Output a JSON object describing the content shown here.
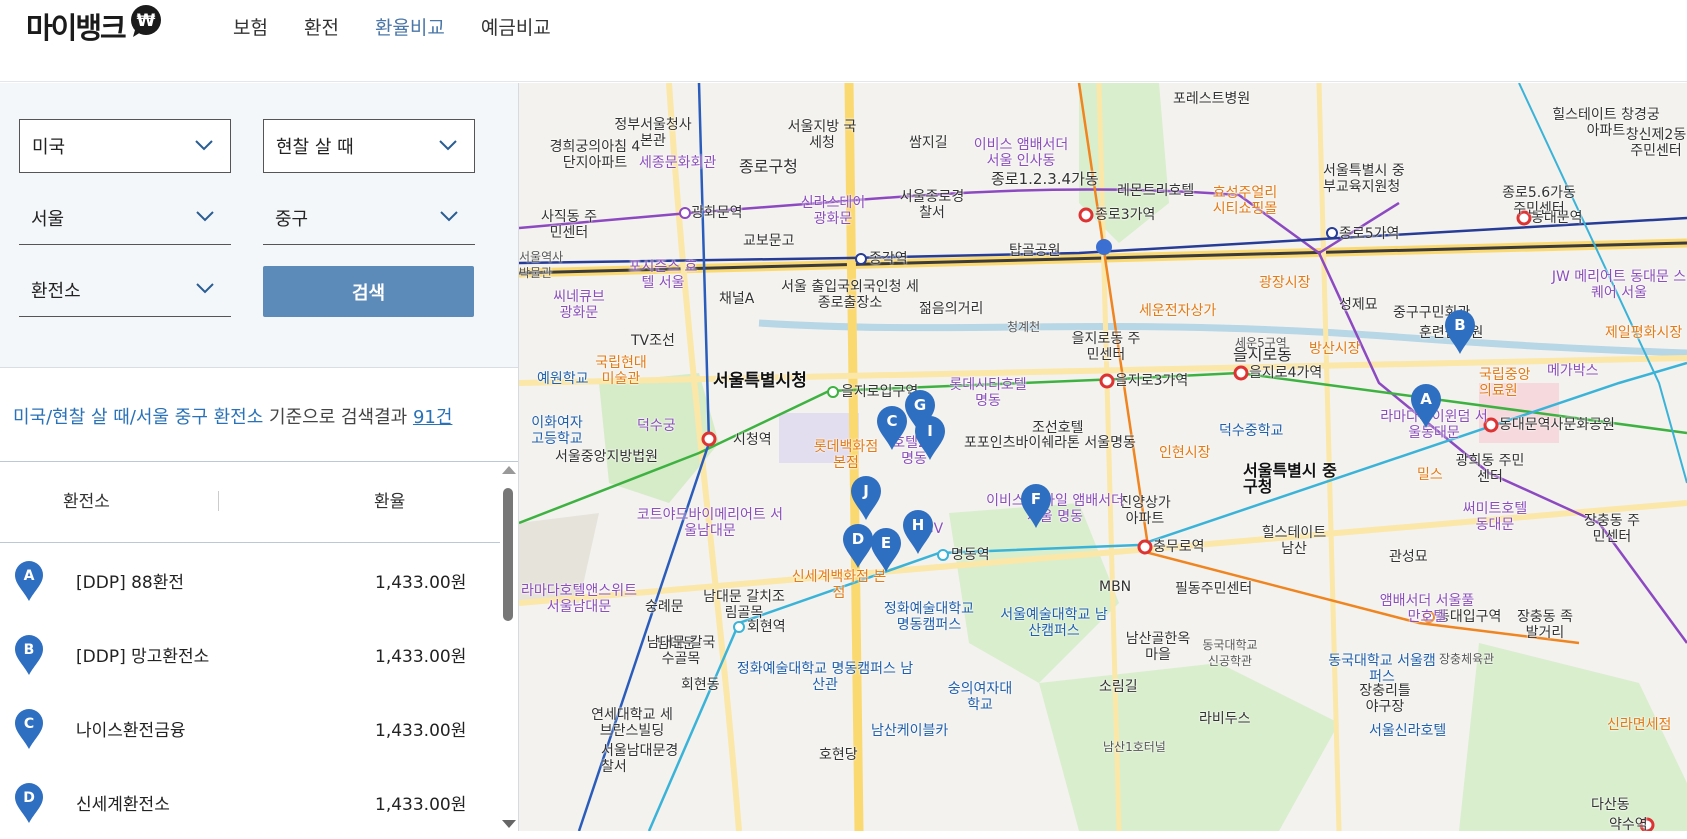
{
  "brand": {
    "logo_text": "마이뱅크",
    "logo_badge": "₩"
  },
  "nav": [
    {
      "label": "보험"
    },
    {
      "label": "환전"
    },
    {
      "label": "환율비교"
    },
    {
      "label": "예금비교"
    }
  ],
  "filters": {
    "country": "미국",
    "trade_type": "현찰 살 때",
    "region": "서울",
    "district": "중구",
    "place_type": "환전소",
    "search_label": "검색"
  },
  "summary": {
    "query": "미국/현찰 살 때/서울 중구 환전소",
    "middle": " 기준으로 검색결과 ",
    "count": "91건"
  },
  "table": {
    "col_name": "환전소",
    "col_rate": "환율",
    "rows": [
      {
        "marker": "A",
        "name": "[DDP] 88환전",
        "rate": "1,433.00원"
      },
      {
        "marker": "B",
        "name": "[DDP] 망고환전소",
        "rate": "1,433.00원"
      },
      {
        "marker": "C",
        "name": "나이스환전금융",
        "rate": "1,433.00원"
      },
      {
        "marker": "D",
        "name": "신세계환전소",
        "rate": "1,433.00원"
      }
    ]
  },
  "map": {
    "markers": [
      "A",
      "B",
      "C",
      "D",
      "E",
      "F",
      "G",
      "H",
      "I",
      "J"
    ],
    "labels": {
      "l1": "서울특별시청",
      "l2": "시청역",
      "l3": "을지로입구역",
      "l4": "을지로3가역",
      "l5": "을지로4가역",
      "l6": "종각역",
      "l7": "광화문역",
      "l8": "종로3가역",
      "l9": "종로5가역",
      "l10": "동대문역",
      "l11": "명동역",
      "l12": "회현역",
      "l13": "충무로역",
      "l14": "동대입구역",
      "l15": "동대문역사문화공원",
      "l16": "서울특별시 중구청",
      "l17": "롯데백화점 본점",
      "l18": "신세계백화점 본점",
      "l19": "덕수궁",
      "l20": "남대문",
      "l21": "광장시장",
      "l22": "방산시장",
      "l23": "세운전자상가",
      "l24": "인현시장",
      "l25": "남산케이블카",
      "l26": "탑골공원",
      "l27": "종로구청",
      "l28": "교보문고",
      "l29": "청계천",
      "l30": "을지로동",
      "l31": "MBN",
      "l32": "필동주민센터",
      "l33": "국립중앙의료원",
      "l34": "메가박스",
      "l35": "서울중앙지방법원",
      "l36": "서울남대문경찰서",
      "l37": "종로1.2.3.4가동",
      "l38": "광희동 주민센터",
      "l39": "훈련원공원",
      "l40": "덕수중학교",
      "l41": "포레스트병원",
      "l42": "숭례문",
      "l43": "CGV",
      "l44": "정화예술대학교 명동캠퍼스",
      "l45": "서울예술대학교 남산캠퍼스",
      "l46": "조선호텔",
      "l47": "포포인츠바이쉐라톤 서울명동",
      "l48": "코트야드바이메리어트 서울남대문",
      "l49": "TV조선",
      "l50": "경희궁의아침 4단지아파트",
      "l51": "서울특별시 중부교육지원청",
      "l52": "신라면세점",
      "l53": "약수역",
      "l54": "정부서울청사 본관",
      "l55": "세종문화회관",
      "l56": "이화여자고등학교",
      "l57": "예원학교",
      "l58": "진양상가 아파트",
      "l59": "힐스테이트 남산",
      "l60": "관성묘",
      "l61": "장충체육관",
      "l62": "숭의여자대학교",
      "l63": "남산골한옥마을",
      "l64": "서울신라호텔",
      "l65": "동국대학교 서울캠퍼스",
      "l66": "성제묘",
      "l67": "제일평화시장",
      "l68": "중구구민회관",
      "l69": "서울 출입국외국인청 세종로출장소",
      "l70": "서울종로경찰서",
      "l71": "신라스테이 광화문",
      "l72": "효성주얼리 시티쇼핑몰",
      "l73": "레몬트리호텔",
      "l74": "젊음의거리",
      "l75": "채널A",
      "l76": "을지로동 주민센터",
      "l77": "세운5구역",
      "l78": "호텔28 명동",
      "l79": "롯데시티호텔 명동",
      "l80": "이비스 앰배서더 서울 인사동",
      "l81": "회현동",
      "l82": "라비두스",
      "l83": "남대문 칼국수골목",
      "l84": "남대문 갈치조림골목",
      "l85": "연세대학교 세브란스빌딩",
      "l86": "호현당",
      "l87": "소림길",
      "l88": "남산1호터널",
      "l89": "장충동 족발거리",
      "l90": "라마다바이윈덤 서울동대문",
      "l91": "JW 메리어트 동대문 스퀘어 서울",
      "l92": "써미트호텔 동대문",
      "l93": "종로5.6가동 주민센터",
      "l94": "창신제2동 주민센터",
      "l95": "힐스테이트 창경궁아파트",
      "l96": "씨네큐브 광화문",
      "l97": "포시즌스 호텔 서울",
      "l98": "서울역사 박물관",
      "l99": "사직동 주민센터",
      "l100": "국립현대 미술관",
      "l101": "밀스",
      "l102": "쌈지길",
      "l103": "서울지방 국세청",
      "l104": "앰배서더 서울풀만호텔",
      "l105": "동국대학교 신공학관",
      "l106": "장충리틀 야구장",
      "l107": "라마다호텔앤스위트 서울남대문",
      "l108": "이비스 스타일 앰배서더 서울 명동",
      "l109": "정화예술대학교 명동캠퍼스 남산관",
      "l110": "장충동 주민센터",
      "l111": "다산동"
    }
  },
  "colors": {
    "accent": "#5d8bb9",
    "marker": "#2f6fc1",
    "link": "#2a72b8"
  }
}
